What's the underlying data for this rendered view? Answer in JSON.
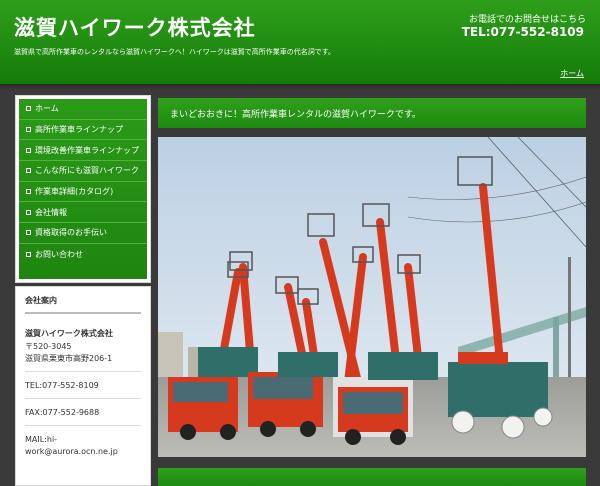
{
  "header": {
    "site_title": "滋賀ハイワーク株式会社",
    "tagline": "滋賀県で高所作業車のレンタルなら滋賀ハイワークへ！ハイワークは滋賀で高所作業車の代名詞です。",
    "contact_label": "お電話でのお問合せはこちら",
    "contact_tel": "TEL:077-552-8109",
    "home_link": "ホーム"
  },
  "nav": {
    "items": [
      {
        "label": "ホーム"
      },
      {
        "label": "高所作業車ラインナップ"
      },
      {
        "label": "環境改善作業車ラインナップ"
      },
      {
        "label": "こんな所にも滋賀ハイワーク"
      },
      {
        "label": "作業車詳細(カタログ)"
      },
      {
        "label": "会社情報"
      },
      {
        "label": "資格取得のお手伝い"
      },
      {
        "label": "お問い合わせ"
      }
    ]
  },
  "company": {
    "heading": "会社案内",
    "name": "滋賀ハイワーク株式会社",
    "postal": "〒520-3045",
    "address": "滋賀県栗東市高野206-1",
    "tel": "TEL:077-552-8109",
    "fax": "FAX:077-552-9688",
    "mail_line1": "MAIL:hi-",
    "mail_line2": "work@aurora.ocn.ne.jp"
  },
  "main": {
    "welcome": "まいどおおきに！高所作業車レンタルの滋賀ハイワークです。"
  },
  "colors": {
    "brand_green": "#1f8a10",
    "truck_red": "#d63a1e",
    "truck_teal": "#2f6f6a"
  }
}
